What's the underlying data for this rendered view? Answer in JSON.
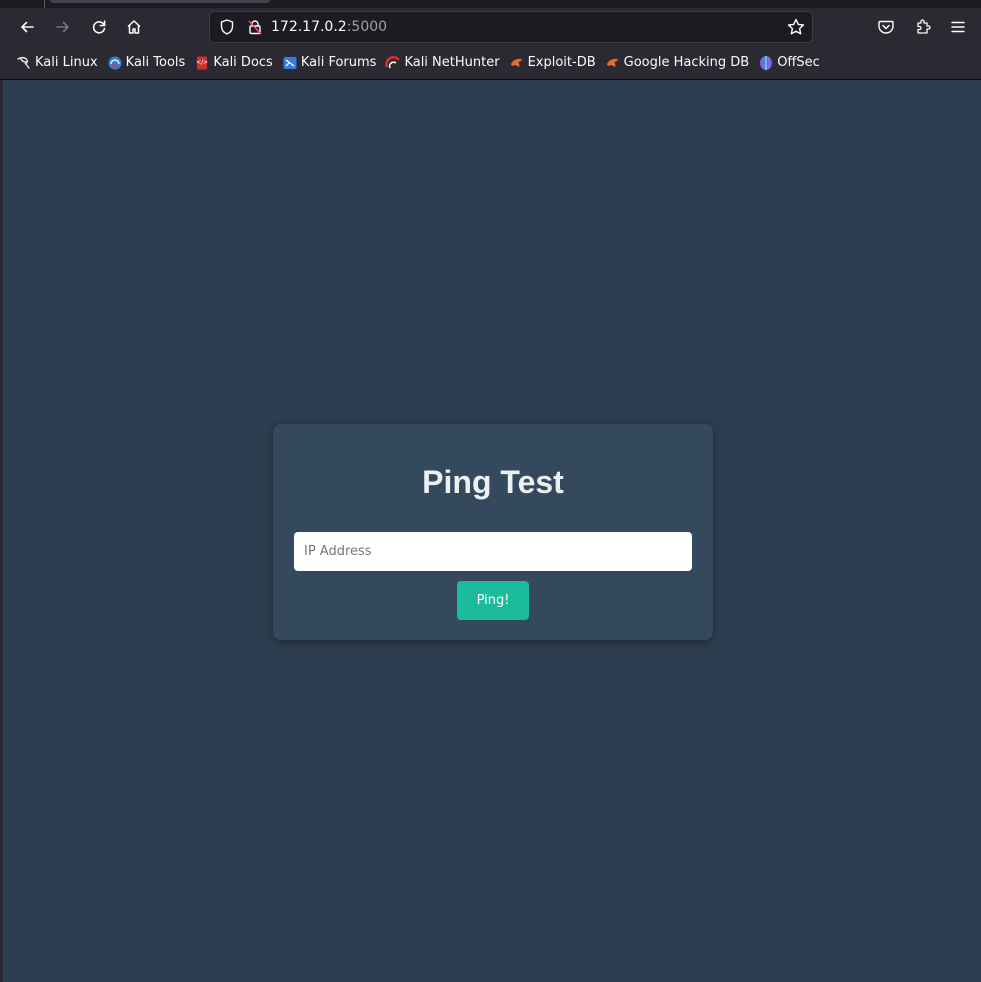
{
  "browser": {
    "url_host": "172.17.0.2",
    "url_port": ":5000",
    "nav": {
      "back_icon": "back-arrow-icon",
      "forward_icon": "forward-arrow-icon",
      "reload_icon": "reload-icon",
      "home_icon": "home-icon"
    },
    "toolbar_icons": [
      "pocket-icon",
      "extensions-icon",
      "hamburger-menu-icon"
    ],
    "bookmarks": [
      {
        "label": "Kali Linux",
        "icon": "kali-dragon-icon",
        "color": "#e8e8ee"
      },
      {
        "label": "Kali Tools",
        "icon": "kali-tools-icon",
        "color": "#3a7bd5"
      },
      {
        "label": "Kali Docs",
        "icon": "kali-docs-icon",
        "color": "#d32f2f"
      },
      {
        "label": "Kali Forums",
        "icon": "kali-forums-icon",
        "color": "#2f7ee0"
      },
      {
        "label": "Kali NetHunter",
        "icon": "nethunter-icon",
        "color": "#d32f2f"
      },
      {
        "label": "Exploit-DB",
        "icon": "exploit-db-icon",
        "color": "#ec6a2c"
      },
      {
        "label": "Google Hacking DB",
        "icon": "ghdb-icon",
        "color": "#ec6a2c"
      },
      {
        "label": "OffSec",
        "icon": "offsec-icon",
        "color": "#5a6fd8"
      }
    ]
  },
  "page": {
    "title": "Ping Test",
    "ip_placeholder": "IP Address",
    "ip_value": "",
    "ping_label": "Ping!",
    "colors": {
      "background": "#2d3e50",
      "card": "#34495e",
      "button": "#1abc9c"
    }
  }
}
